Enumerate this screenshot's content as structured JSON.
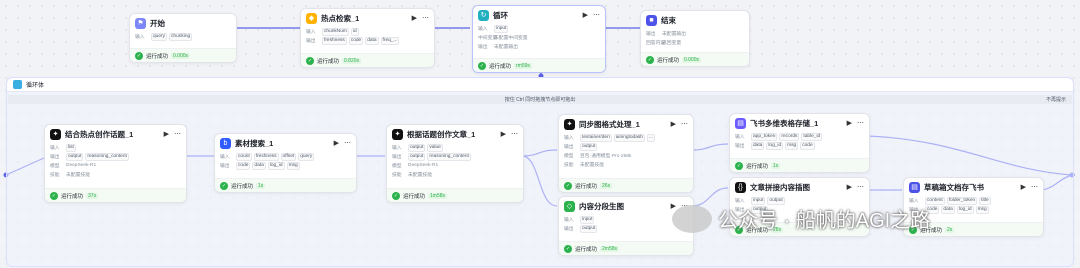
{
  "top": {
    "start": {
      "title": "开始",
      "in_label": "输入",
      "inputs": [
        "query",
        "chunking"
      ],
      "status": "运行成功",
      "time": "0.000s"
    },
    "search": {
      "title": "热点检索_1",
      "in_label": "输入",
      "inputs": [
        "chunkNum",
        "id"
      ],
      "out_label": "输出",
      "outputs": [
        "freshness",
        "code",
        "data",
        "freq_..."
      ],
      "status": "运行成功",
      "time": "0.820s"
    },
    "loop": {
      "title": "循环",
      "in_label": "输入",
      "inputs": [
        "input"
      ],
      "var_label": "中间变量",
      "var_value": "未配置中间变量",
      "out_label": "输出",
      "out_value": "未配置输出",
      "status": "运行成功",
      "time": "rm59s"
    },
    "end": {
      "title": "结束",
      "out_label": "输出",
      "out_value": "未配置输出",
      "ret_label": "回答内容",
      "ret_value": "返回变量",
      "status": "运行成功",
      "time": "0.000s"
    }
  },
  "loop_body": {
    "title": "循环体",
    "hint": "按住 Ctrl 同时拖拽节点即可拖出",
    "hint_right": "不再提示"
  },
  "inner": {
    "n1": {
      "title": "结合热点创作话题_1",
      "in_label": "输入",
      "inputs": [
        "list"
      ],
      "out_label": "输出",
      "outputs": [
        "output",
        "reasoning_content"
      ],
      "model_label": "模型",
      "model": "DeepSeek-R1",
      "skill_label": "技能",
      "skill": "未配置技能",
      "status": "运行成功",
      "time": "37s"
    },
    "n2": {
      "title": "素材搜索_1",
      "in_label": "输入",
      "inputs": [
        "count",
        "freshness",
        "offset",
        "query"
      ],
      "out_label": "输出",
      "outputs": [
        "code",
        "data",
        "log_id",
        "msg"
      ],
      "status": "运行成功",
      "time": "1s"
    },
    "n3": {
      "title": "根据话题创作文章_1",
      "in_label": "输入",
      "inputs": [
        "output",
        "value"
      ],
      "out_label": "输出",
      "outputs": [
        "output",
        "reasoning_content"
      ],
      "model_label": "模型",
      "model": "DeepSeek-R1",
      "skill_label": "技能",
      "skill": "未配置技能",
      "status": "运行成功",
      "time": "1m58s"
    },
    "n4": {
      "title": "同步图格式处理_1",
      "in_label": "输入",
      "inputs": [
        "textainer/den",
        "ainingtodash",
        "..."
      ],
      "out_label": "输出",
      "outputs": [
        "output"
      ],
      "model_label": "模型",
      "model": "豆包·通用模型·Pro·256k",
      "skill_label": "技能",
      "skill": "未配置技能",
      "status": "运行成功",
      "time": "26s"
    },
    "n5": {
      "title": "内容分段生图",
      "in_label": "输入",
      "inputs": [
        "input"
      ],
      "out_label": "输出",
      "outputs": [
        "output"
      ],
      "status": "运行成功",
      "time": "2m58s"
    },
    "n6": {
      "title": "飞书多维表格存储_1",
      "in_label": "输入",
      "inputs": [
        "app_token",
        "records",
        "table_id"
      ],
      "out_label": "输出",
      "outputs": [
        "data",
        "log_id",
        "msg",
        "code"
      ],
      "status": "运行成功",
      "time": "1s"
    },
    "n7": {
      "title": "文章拼接内容插图",
      "in_label": "输入",
      "inputs": [
        "input",
        "output"
      ],
      "out_label": "输出",
      "outputs": [
        "output"
      ],
      "status": "运行成功",
      "time": "28s"
    },
    "n8": {
      "title": "草稿箱文档存飞书",
      "in_label": "输入",
      "inputs": [
        "content",
        "folder_token",
        "title"
      ],
      "out_label": "输出",
      "outputs": [
        "code",
        "data",
        "log_id",
        "msg"
      ],
      "status": "运行成功",
      "time": "2s"
    }
  },
  "watermark": {
    "text": "公众号 · 船帆的AGI之路"
  },
  "colors": {
    "accent": "#4d53e8",
    "success": "#2bb24c",
    "start": "#7b87f5",
    "plugin": "#ffb300",
    "loop": "#22b0c0",
    "end": "#4d53e8",
    "llm": "#111111",
    "search": "#2f5bff",
    "feishu": "#6b5cff"
  }
}
